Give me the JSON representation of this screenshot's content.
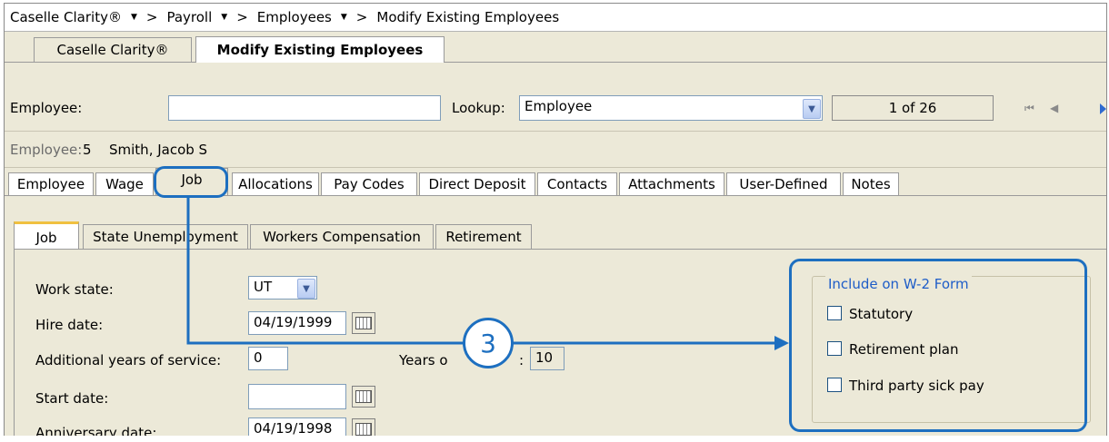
{
  "breadcrumb": {
    "items": [
      "Caselle Clarity®",
      "Payroll",
      "Employees",
      "Modify Existing Employees"
    ],
    "separator": ">",
    "arrow": "▼"
  },
  "doc_tabs": [
    "Caselle Clarity®",
    "Modify Existing Employees"
  ],
  "employee_row": {
    "employee_label": "Employee:",
    "employee_value": "",
    "lookup_label": "Lookup:",
    "lookup_value": "Employee",
    "record_position": "1 of 26"
  },
  "employee_info": {
    "label": "Employee:",
    "number": "5",
    "name": "Smith, Jacob S"
  },
  "record_tabs": [
    "Employee",
    "Wage",
    "Job",
    "Allocations",
    "Pay Codes",
    "Direct Deposit",
    "Contacts",
    "Attachments",
    "User-Defined",
    "Notes"
  ],
  "job_subtabs": [
    "Job",
    "State Unemployment",
    "Workers Compensation",
    "Retirement"
  ],
  "job_form": {
    "work_state_label": "Work state:",
    "work_state_value": "UT",
    "hire_date_label": "Hire date:",
    "hire_date_value": "04/19/1999",
    "additional_years_label": "Additional years of service:",
    "additional_years_value": "0",
    "years_of_service_label": "Years o",
    "years_of_service_suffix": ":",
    "years_of_service_value": "10",
    "start_date_label": "Start date:",
    "start_date_value": "",
    "anniversary_date_label": "Anniversary date:",
    "anniversary_date_value": "04/19/1998"
  },
  "w2_group": {
    "title": "Include on W-2 Form",
    "options": [
      {
        "label": "Statutory",
        "checked": false
      },
      {
        "label": "Retirement plan",
        "checked": false
      },
      {
        "label": "Third party sick pay",
        "checked": false
      }
    ]
  },
  "callout": {
    "number": "3",
    "color": "#1d6fc0"
  }
}
